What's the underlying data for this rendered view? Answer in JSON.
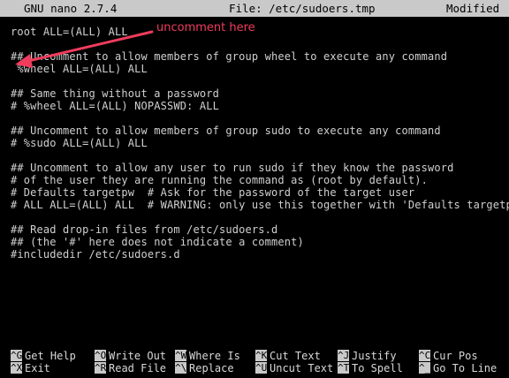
{
  "titlebar": {
    "app": "GNU nano 2.7.4",
    "file": "File: /etc/sudoers.tmp",
    "status": "Modified"
  },
  "editor": {
    "lines": [
      "root ALL=(ALL) ALL",
      "",
      "## Uncomment to allow members of group wheel to execute any command",
      " %wheel ALL=(ALL) ALL",
      "",
      "## Same thing without a password",
      "# %wheel ALL=(ALL) NOPASSWD: ALL",
      "",
      "## Uncomment to allow members of group sudo to execute any command",
      "# %sudo ALL=(ALL) ALL",
      "",
      "## Uncomment to allow any user to run sudo if they know the password",
      "# of the user they are running the command as (root by default).",
      "# Defaults targetpw  # Ask for the password of the target user",
      "# ALL ALL=(ALL) ALL  # WARNING: only use this together with 'Defaults targetpw'",
      "",
      "## Read drop-in files from /etc/sudoers.d",
      "## (the '#' here does not indicate a comment)",
      "#includedir /etc/sudoers.d"
    ]
  },
  "shortcuts": [
    {
      "key1": "^G",
      "label1": "Get Help",
      "key2": "^X",
      "label2": "Exit"
    },
    {
      "key1": "^O",
      "label1": "Write Out",
      "key2": "^R",
      "label2": "Read File"
    },
    {
      "key1": "^W",
      "label1": "Where Is",
      "key2": "^\\",
      "label2": "Replace"
    },
    {
      "key1": "^K",
      "label1": "Cut Text",
      "key2": "^U",
      "label2": "Uncut Text"
    },
    {
      "key1": "^J",
      "label1": "Justify",
      "key2": "^T",
      "label2": "To Spell"
    },
    {
      "key1": "^C",
      "label1": "Cur Pos",
      "key2": "^_",
      "label2": "Go To Line"
    }
  ],
  "annotation": {
    "text": "uncomment here",
    "color": "#f03c5c"
  }
}
